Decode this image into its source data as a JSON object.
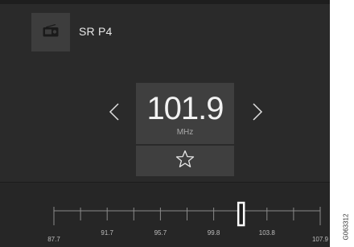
{
  "station": {
    "name": "SR P4",
    "icon": "radio-icon"
  },
  "frequency": {
    "value": "101.9",
    "unit": "MHz"
  },
  "controls": {
    "prev_icon": "chevron-left-icon",
    "next_icon": "chevron-right-icon",
    "favorite_icon": "star-outline-icon"
  },
  "tuner": {
    "labels": [
      "87.7",
      "91.7",
      "95.7",
      "99.8",
      "103.8",
      "107.9"
    ],
    "min": 87.7,
    "max": 107.9,
    "current": 101.9
  },
  "image_code": "G063312",
  "colors": {
    "background": "#2a2a2a",
    "panel": "#3f3f3f",
    "text": "#f2f2f2"
  }
}
